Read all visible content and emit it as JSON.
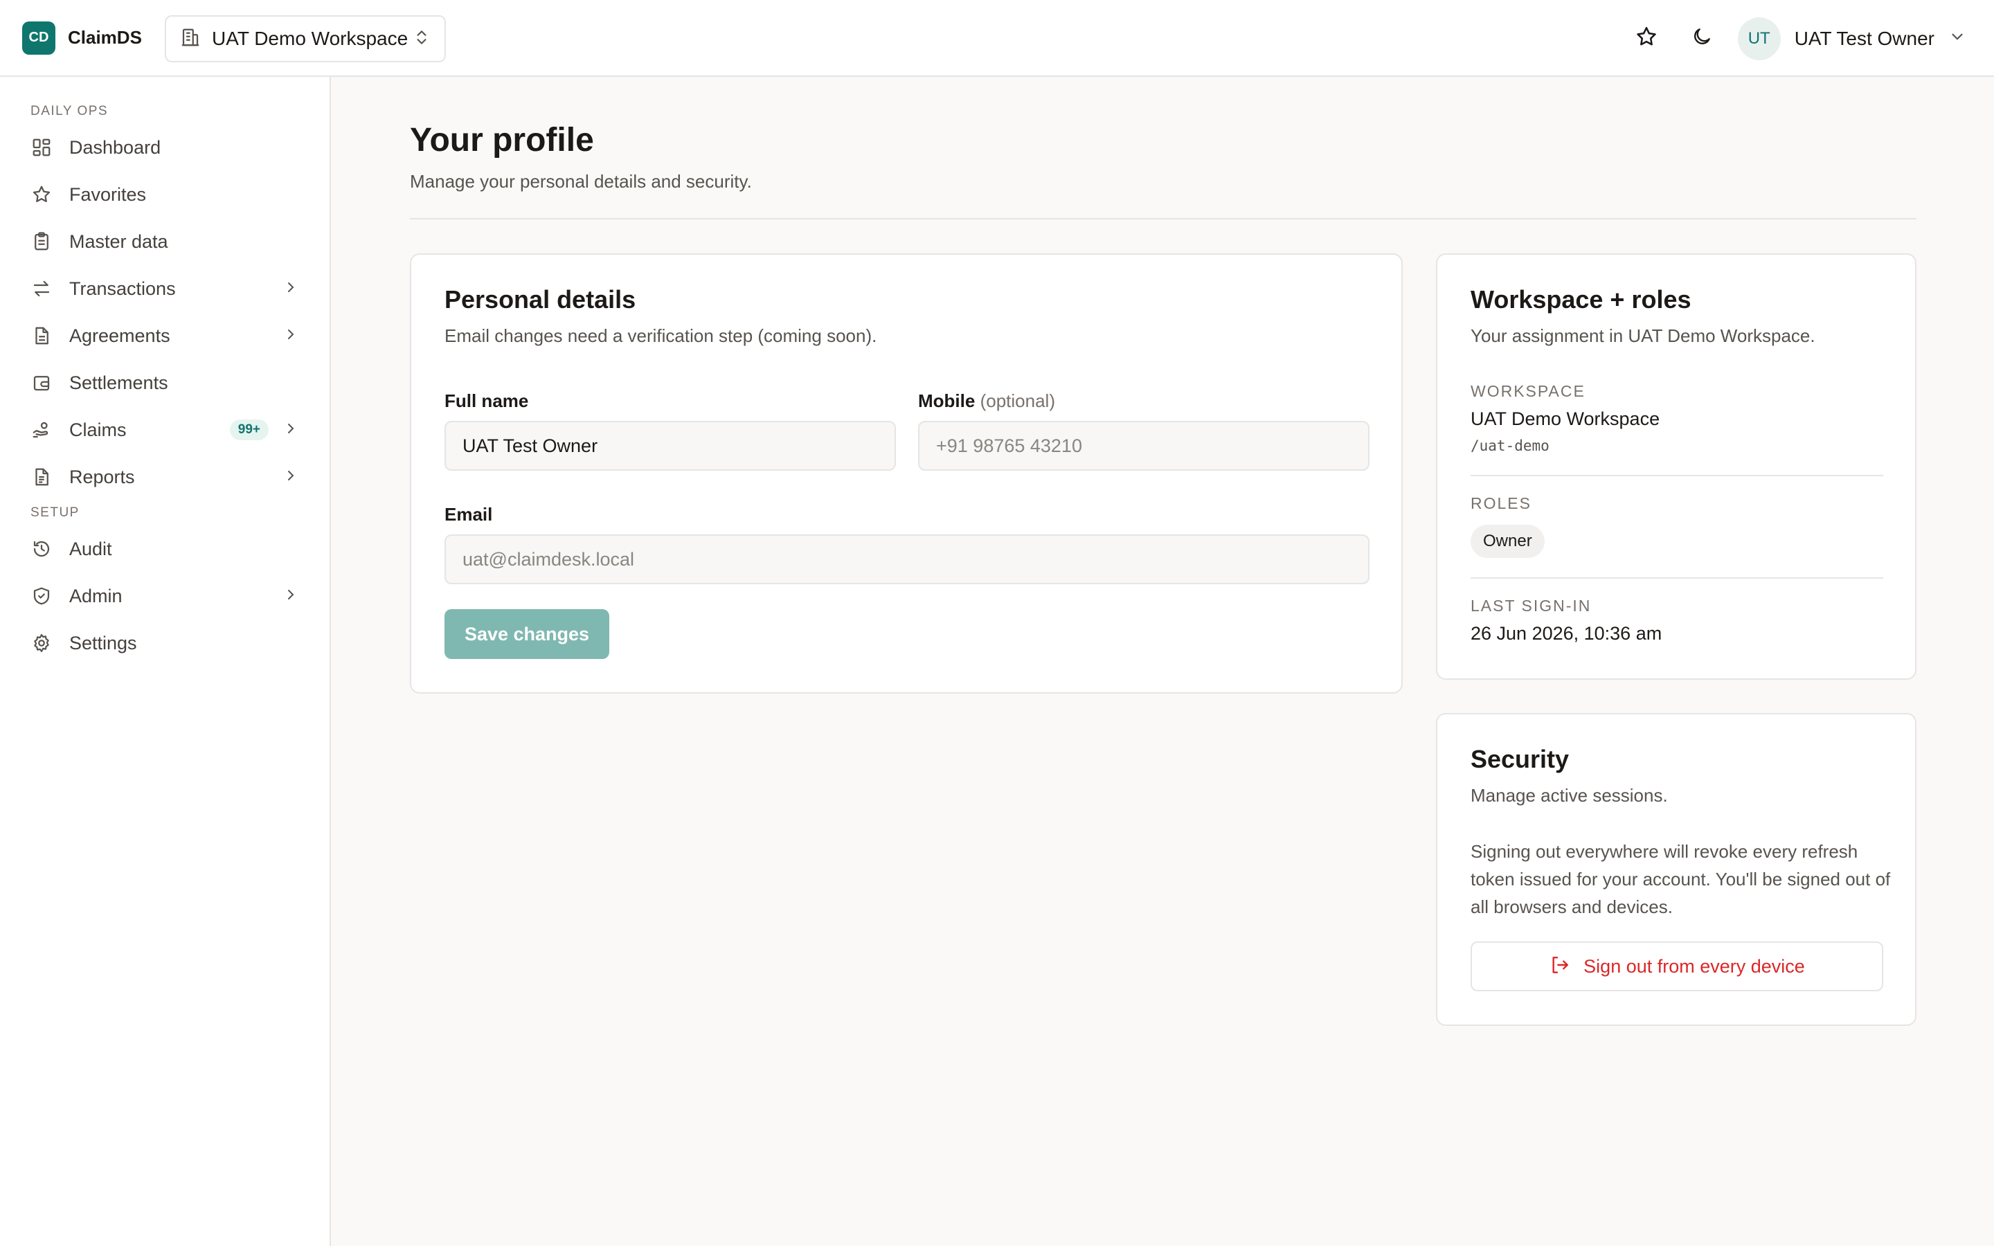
{
  "brand": {
    "logo_text": "CD",
    "name": "ClaimDS"
  },
  "workspace_switcher": {
    "label": "UAT Demo Workspace"
  },
  "user": {
    "initials": "UT",
    "name": "UAT Test Owner"
  },
  "sidebar": {
    "sections": [
      {
        "label": "DAILY OPS"
      },
      {
        "label": "SETUP"
      }
    ],
    "items": [
      {
        "label": "Dashboard",
        "icon": "grid-icon"
      },
      {
        "label": "Favorites",
        "icon": "star-icon"
      },
      {
        "label": "Master data",
        "icon": "clipboard-icon"
      },
      {
        "label": "Transactions",
        "icon": "arrows-icon",
        "expandable": true
      },
      {
        "label": "Agreements",
        "icon": "document-icon",
        "expandable": true
      },
      {
        "label": "Settlements",
        "icon": "wallet-icon"
      },
      {
        "label": "Claims",
        "icon": "hand-coins-icon",
        "badge": "99+",
        "expandable": true
      },
      {
        "label": "Reports",
        "icon": "report-icon",
        "expandable": true
      },
      {
        "label": "Audit",
        "icon": "history-icon"
      },
      {
        "label": "Admin",
        "icon": "shield-icon",
        "expandable": true
      },
      {
        "label": "Settings",
        "icon": "gear-icon"
      }
    ]
  },
  "page": {
    "title": "Your profile",
    "subtitle": "Manage your personal details and security."
  },
  "personal": {
    "title": "Personal details",
    "subtitle": "Email changes need a verification step (coming soon).",
    "full_name_label": "Full name",
    "full_name_value": "UAT Test Owner",
    "mobile_label": "Mobile",
    "mobile_optional": "(optional)",
    "mobile_placeholder": "+91 98765 43210",
    "email_label": "Email",
    "email_value": "uat@claimdesk.local",
    "save_label": "Save changes"
  },
  "workspace_card": {
    "title": "Workspace + roles",
    "subtitle": "Your assignment in UAT Demo Workspace.",
    "workspace_label": "WORKSPACE",
    "workspace_name": "UAT Demo Workspace",
    "workspace_slug": "/uat-demo",
    "roles_label": "ROLES",
    "role": "Owner",
    "last_signin_label": "LAST SIGN-IN",
    "last_signin_value": "26 Jun 2026, 10:36 am"
  },
  "security": {
    "title": "Security",
    "subtitle": "Manage active sessions.",
    "description": "Signing out everywhere will revoke every refresh token issued for your account. You'll be signed out of all browsers and devices.",
    "signout_label": "Sign out from every device"
  },
  "colors": {
    "accent": "#0f766e",
    "button_disabled": "#7fb8b0",
    "danger": "#dc2626",
    "background": "#faf9f7"
  }
}
